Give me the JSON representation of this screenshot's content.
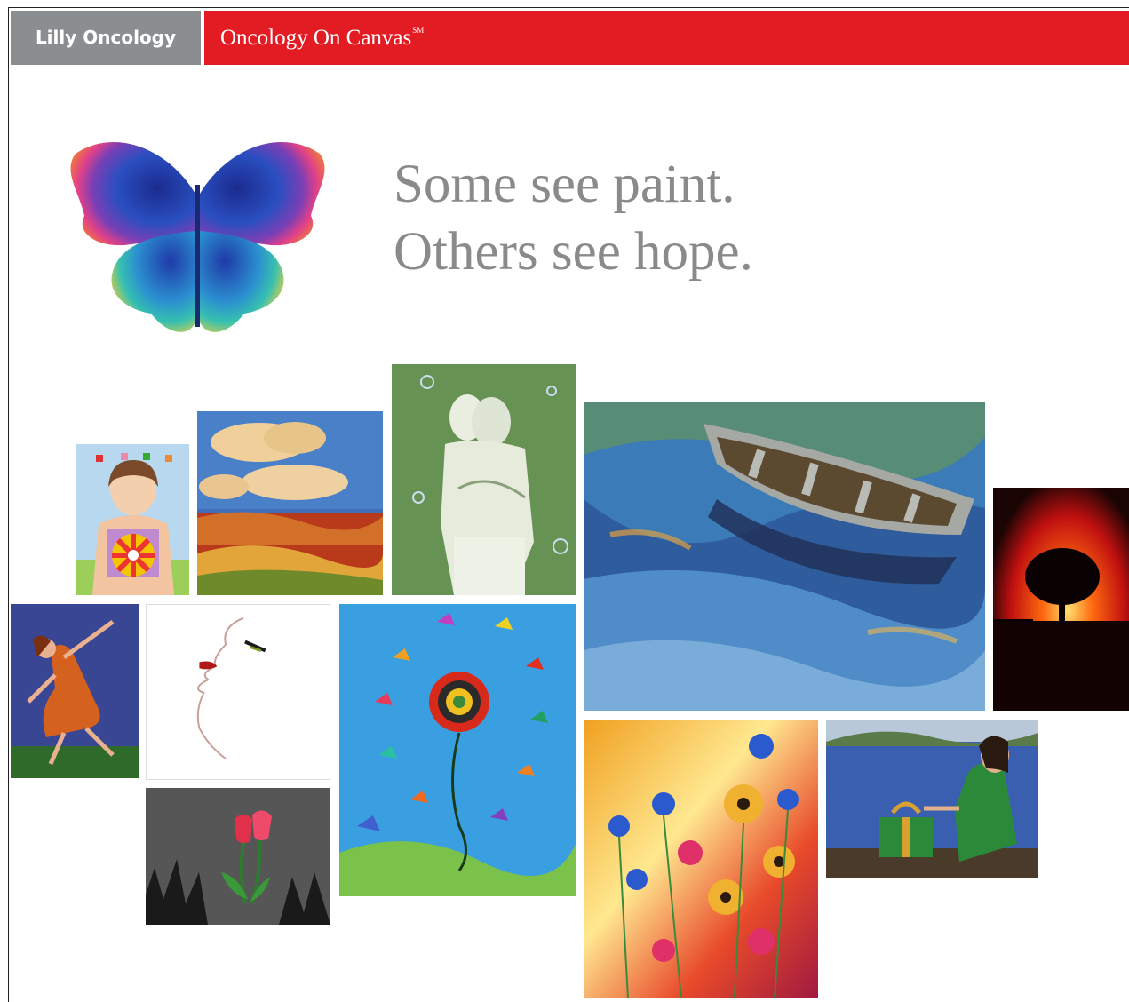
{
  "header": {
    "brand": "Lilly Oncology",
    "program": "Oncology On Canvas",
    "program_mark": "SM",
    "colors": {
      "grey": "#8b8e91",
      "red": "#e31b23"
    }
  },
  "headline": {
    "line1": "Some see paint.",
    "line2": "Others see hope."
  },
  "artworks": [
    "woman-with-color-wheel-painting",
    "clouds-over-field-painting",
    "embracing-couple-green-sketch",
    "rowboat-on-water-painting",
    "tree-at-red-sunset-photo",
    "dancing-woman-mosaic",
    "face-profile-sketch",
    "butterfly-spiral-painting",
    "red-tulips-painting",
    "bright-flowers-painting",
    "woman-with-gift-by-lake-painting"
  ]
}
